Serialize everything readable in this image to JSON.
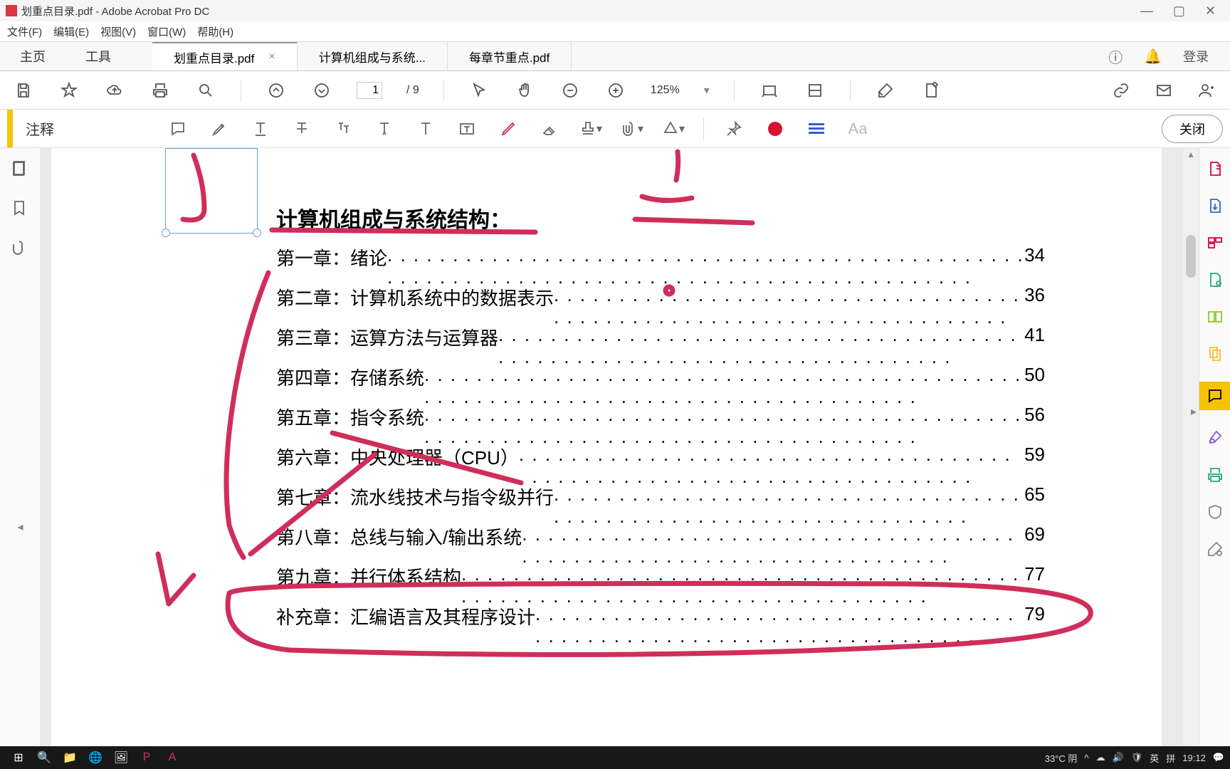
{
  "window": {
    "title": "划重点目录.pdf - Adobe Acrobat Pro DC",
    "minimize": "—",
    "maximize": "▢",
    "close": "✕"
  },
  "menu": {
    "file": "文件(F)",
    "edit": "编辑(E)",
    "view": "视图(V)",
    "window": "窗口(W)",
    "help": "帮助(H)"
  },
  "tabs": {
    "home": "主页",
    "tools": "工具",
    "docs": [
      {
        "label": "划重点目录.pdf",
        "active": true,
        "closable": true
      },
      {
        "label": "计算机组成与系统...",
        "active": false,
        "closable": false
      },
      {
        "label": "每章节重点.pdf",
        "active": false,
        "closable": false
      }
    ],
    "login": "登录"
  },
  "toolbar": {
    "page_current": "1",
    "page_total": "/ 9",
    "zoom": "125%"
  },
  "annotoolbar": {
    "label": "注释",
    "close": "关闭",
    "font_placeholder": "Aa"
  },
  "document": {
    "title": "计算机组成与系统结构：",
    "toc": [
      {
        "chapter": "第一章：",
        "title": "绪论",
        "page": "34"
      },
      {
        "chapter": "第二章：",
        "title": "计算机系统中的数据表示",
        "page": "36"
      },
      {
        "chapter": "第三章：",
        "title": "运算方法与运算器",
        "page": "41"
      },
      {
        "chapter": "第四章：",
        "title": "存储系统",
        "page": "50"
      },
      {
        "chapter": "第五章：",
        "title": "指令系统",
        "page": "56"
      },
      {
        "chapter": "第六章：",
        "title": "中央处理器（CPU）",
        "page": "59"
      },
      {
        "chapter": "第七章：",
        "title": "流水线技术与指令级并行",
        "page": "65"
      },
      {
        "chapter": "第八章：",
        "title": "总线与输入/输出系统",
        "page": "69"
      },
      {
        "chapter": "第九章：",
        "title": "并行体系结构",
        "page": "77"
      },
      {
        "chapter": "补充章：",
        "title": "汇编语言及其程序设计",
        "page": "79"
      }
    ]
  },
  "taskbar": {
    "weather": "33°C 阴",
    "ime1": "英",
    "ime2": "拼",
    "time": "19:12"
  }
}
